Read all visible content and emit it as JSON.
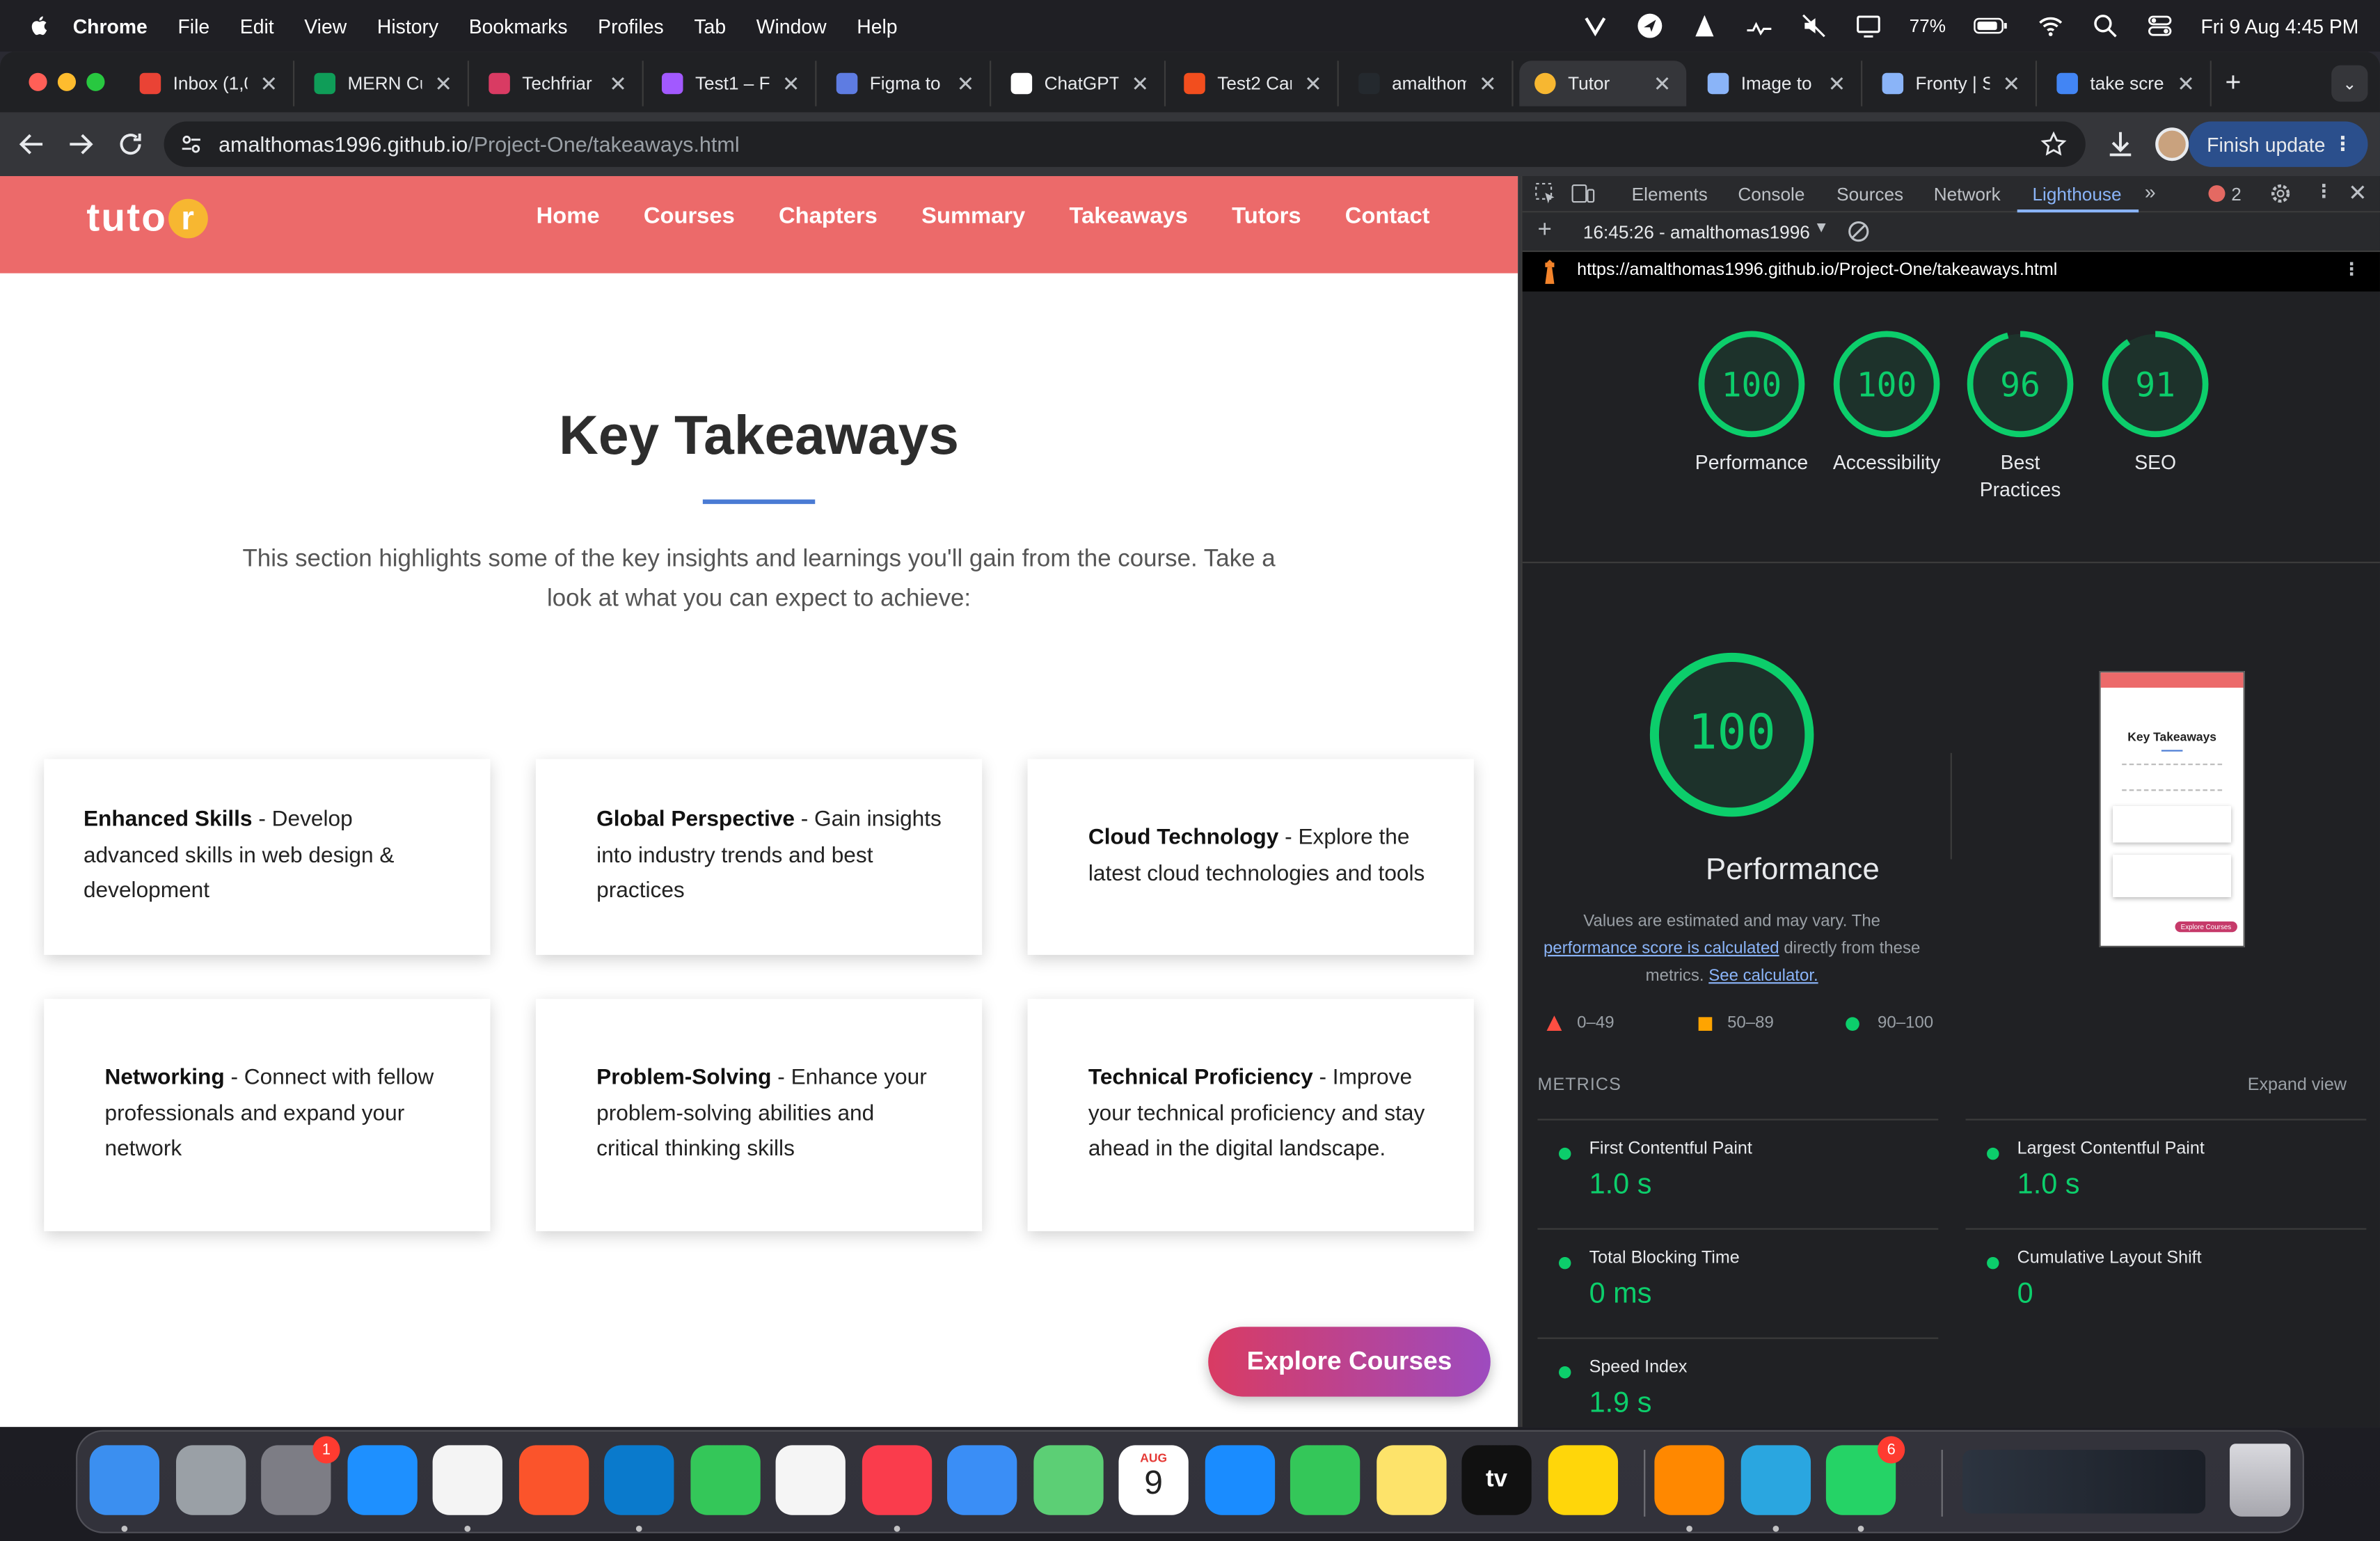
{
  "menubar": {
    "app_name": "Chrome",
    "items": [
      "File",
      "Edit",
      "View",
      "History",
      "Bookmarks",
      "Profiles",
      "Tab",
      "Window",
      "Help"
    ],
    "battery": "77%",
    "clock": "Fri 9 Aug  4:45 PM"
  },
  "tabs": [
    {
      "label": "Inbox (1,0",
      "icon": "gmail-icon",
      "color": "#ea4335"
    },
    {
      "label": "MERN Cu",
      "icon": "sheets-icon",
      "color": "#0f9d58"
    },
    {
      "label": "Techfriar",
      "icon": "dash-icon",
      "color": "#d93b63"
    },
    {
      "label": "Test1 – Fi",
      "icon": "figma-icon",
      "color": "#a259ff"
    },
    {
      "label": "Figma to",
      "icon": "figma-plugin-icon",
      "color": "#5e7ce2"
    },
    {
      "label": "ChatGPT",
      "icon": "chatgpt-icon",
      "color": "#ffffff"
    },
    {
      "label": "Test2 Car",
      "icon": "figma-icon",
      "color": "#f24e1e"
    },
    {
      "label": "amalthom",
      "icon": "github-icon",
      "color": "#24292e"
    },
    {
      "label": "Tutor",
      "icon": "tutor-icon",
      "color": "#f7b731",
      "active": true
    },
    {
      "label": "Image to",
      "icon": "code-icon",
      "color": "#8ab4f8"
    },
    {
      "label": "Fronty | S",
      "icon": "code-icon",
      "color": "#8ab4f8"
    },
    {
      "label": "take scre",
      "icon": "google-icon",
      "color": "#4285f4"
    }
  ],
  "toolbar": {
    "url_host": "amalthomas1996.github.io",
    "url_path": "/Project-One/takeaways.html",
    "finish_update": "Finish update"
  },
  "site": {
    "logo_text": "tuto",
    "logo_dot": "r",
    "nav": [
      "Home",
      "Courses",
      "Chapters",
      "Summary",
      "Takeaways",
      "Tutors",
      "Contact"
    ],
    "title": "Key Takeaways",
    "intro": "This section highlights some of the key insights and learnings you'll gain from the course. Take a look at what you can expect to achieve:",
    "cards": [
      {
        "title": "Enhanced Skills",
        "desc": " - Develop advanced skills in web design & development"
      },
      {
        "title": "Global Perspective",
        "desc": " - Gain insights into industry trends and best practices"
      },
      {
        "title": "Cloud Technology",
        "desc": " - Explore the latest cloud technologies and tools"
      },
      {
        "title": "Networking",
        "desc": " - Connect with fellow professionals and expand your network"
      },
      {
        "title": "Problem-Solving",
        "desc": " - Enhance your problem-solving abilities and critical thinking skills"
      },
      {
        "title": "Technical Proficiency",
        "desc": " - Improve your technical proficiency and stay ahead in the digital landscape."
      }
    ],
    "cta": "Explore Courses"
  },
  "devtools": {
    "tabs": [
      "Elements",
      "Console",
      "Sources",
      "Network",
      "Lighthouse"
    ],
    "error_count": "2",
    "report_label": "16:45:26 - amalthomas1996",
    "report_url": "https://amalthomas1996.github.io/Project-One/takeaways.html",
    "scores": [
      {
        "value": "100",
        "label": "Performance",
        "fraction": 1.0
      },
      {
        "value": "100",
        "label": "Accessibility",
        "fraction": 1.0
      },
      {
        "value": "96",
        "label": "Best Practices",
        "fraction": 0.96
      },
      {
        "value": "91",
        "label": "SEO",
        "fraction": 0.91
      }
    ],
    "big_score": "100",
    "big_label": "Performance",
    "note_pre": "Values are estimated and may vary. The ",
    "note_link": "performance score is calculated",
    "note_mid": " directly from these metrics. ",
    "note_link2": "See calculator.",
    "legend": [
      "0–49",
      "50–89",
      "90–100"
    ],
    "metrics_heading": "METRICS",
    "expand_view": "Expand view",
    "metrics": [
      {
        "name": "First Contentful Paint",
        "value": "1.0 s"
      },
      {
        "name": "Largest Contentful Paint",
        "value": "1.0 s"
      },
      {
        "name": "Total Blocking Time",
        "value": "0 ms"
      },
      {
        "name": "Cumulative Layout Shift",
        "value": "0"
      },
      {
        "name": "Speed Index",
        "value": "1.9 s"
      }
    ],
    "thumb_title": "Key Takeaways",
    "thumb_cta": "Explore Courses",
    "colors": {
      "pass": "#0cce6b",
      "average": "#ffa400",
      "fail": "#ff4e42"
    }
  },
  "dock": {
    "apps": [
      {
        "name": "finder-icon",
        "color": "#3b8ff0",
        "running": true
      },
      {
        "name": "launchpad-icon",
        "color": "#9aa0a6",
        "running": false
      },
      {
        "name": "system-settings-icon",
        "color": "#7d7d85",
        "running": false,
        "badge": "1"
      },
      {
        "name": "safari-icon",
        "color": "#1e90ff",
        "running": false
      },
      {
        "name": "chrome-icon",
        "color": "#f4f4f4",
        "running": true
      },
      {
        "name": "brave-icon",
        "color": "#fb542b",
        "running": false
      },
      {
        "name": "vscode-icon",
        "color": "#0a7acc",
        "running": true
      },
      {
        "name": "messages-icon",
        "color": "#34c759",
        "running": false
      },
      {
        "name": "photos-icon",
        "color": "#f5f5f5",
        "running": false
      },
      {
        "name": "music-icon",
        "color": "#fa3c4c",
        "running": true
      },
      {
        "name": "mail-icon",
        "color": "#3a8ef6",
        "running": false
      },
      {
        "name": "maps-icon",
        "color": "#5ccf75",
        "running": false
      },
      {
        "name": "calendar-icon",
        "color": "#ffffff",
        "running": false
      },
      {
        "name": "app-store-icon",
        "color": "#1a8cff",
        "running": false
      },
      {
        "name": "facetime-icon",
        "color": "#34c759",
        "running": false
      },
      {
        "name": "notes-icon",
        "color": "#fde36a",
        "running": false
      },
      {
        "name": "apple-tv-icon",
        "color": "#111111",
        "running": false
      },
      {
        "name": "tips-icon",
        "color": "#ffd60a",
        "running": false
      },
      {
        "name": "vlc-icon",
        "color": "#ff8800",
        "running": true
      },
      {
        "name": "telegram-icon",
        "color": "#2aa6e0",
        "running": true
      },
      {
        "name": "whatsapp-icon",
        "color": "#25d366",
        "running": true,
        "badge": "6"
      }
    ],
    "calendar_month": "AUG",
    "calendar_day": "9",
    "apple_tv_label": "tv"
  }
}
